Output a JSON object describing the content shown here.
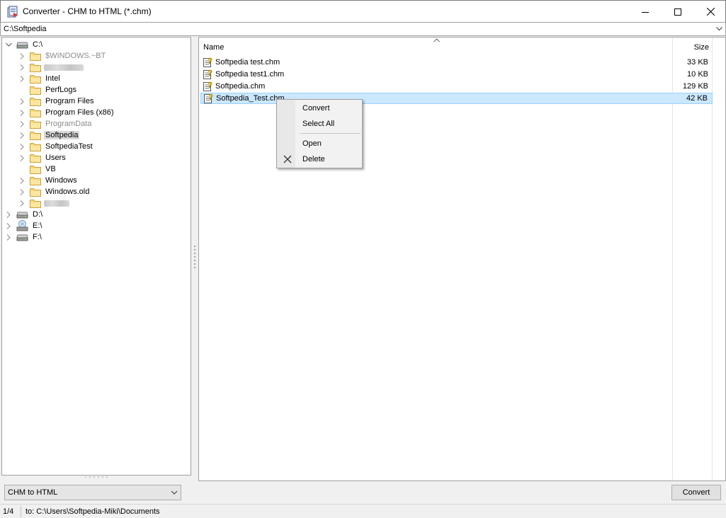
{
  "window": {
    "title": "Converter - CHM to HTML (*.chm)"
  },
  "path_bar": {
    "value": "C:\\Softpedia"
  },
  "tree": {
    "items": [
      {
        "label": "C:\\",
        "type": "drive",
        "expanded": true
      },
      {
        "label": "$WINDOWS.~BT",
        "type": "folder",
        "dim": true
      },
      {
        "label": "",
        "type": "folder",
        "redacted": true
      },
      {
        "label": "Intel",
        "type": "folder"
      },
      {
        "label": "PerfLogs",
        "type": "folder"
      },
      {
        "label": "Program Files",
        "type": "folder"
      },
      {
        "label": "Program Files (x86)",
        "type": "folder"
      },
      {
        "label": "ProgramData",
        "type": "folder",
        "dim": true
      },
      {
        "label": "Softpedia",
        "type": "folder",
        "selected": true
      },
      {
        "label": "SoftpediaTest",
        "type": "folder"
      },
      {
        "label": "Users",
        "type": "folder"
      },
      {
        "label": "VB",
        "type": "folder"
      },
      {
        "label": "Windows",
        "type": "folder"
      },
      {
        "label": "Windows.old",
        "type": "folder"
      },
      {
        "label": "",
        "type": "folder",
        "redacted": true
      },
      {
        "label": "D:\\",
        "type": "drive"
      },
      {
        "label": "E:\\",
        "type": "cd-drive"
      },
      {
        "label": "F:\\",
        "type": "drive"
      }
    ]
  },
  "file_list": {
    "columns": {
      "name": "Name",
      "size": "Size"
    },
    "files": [
      {
        "name": "Softpedia test.chm",
        "size": "33 KB"
      },
      {
        "name": "Softpedia test1.chm",
        "size": "10 KB"
      },
      {
        "name": "Softpedia.chm",
        "size": "129 KB"
      },
      {
        "name": "Softpedia_Test.chm",
        "size": "42 KB",
        "selected": true
      }
    ]
  },
  "context_menu": {
    "convert": "Convert",
    "select_all": "Select All",
    "open": "Open",
    "delete": "Delete"
  },
  "bottom": {
    "mode": "CHM to HTML",
    "convert_label": "Convert"
  },
  "status": {
    "count": "1/4",
    "destination": "to: C:\\Users\\Softpedia-Miki\\Documents"
  },
  "colors": {
    "selection_fill": "#cce8ff",
    "selection_border": "#99d1ff",
    "folder": "#f8d775",
    "dim_text": "#8c8c8c"
  },
  "icons": {
    "app": "converter-app-icon",
    "folder": "folder-icon",
    "drive": "hard-drive-icon",
    "cd_drive": "cd-drive-icon",
    "chm": "chm-file-icon",
    "delete": "delete-x-icon"
  }
}
